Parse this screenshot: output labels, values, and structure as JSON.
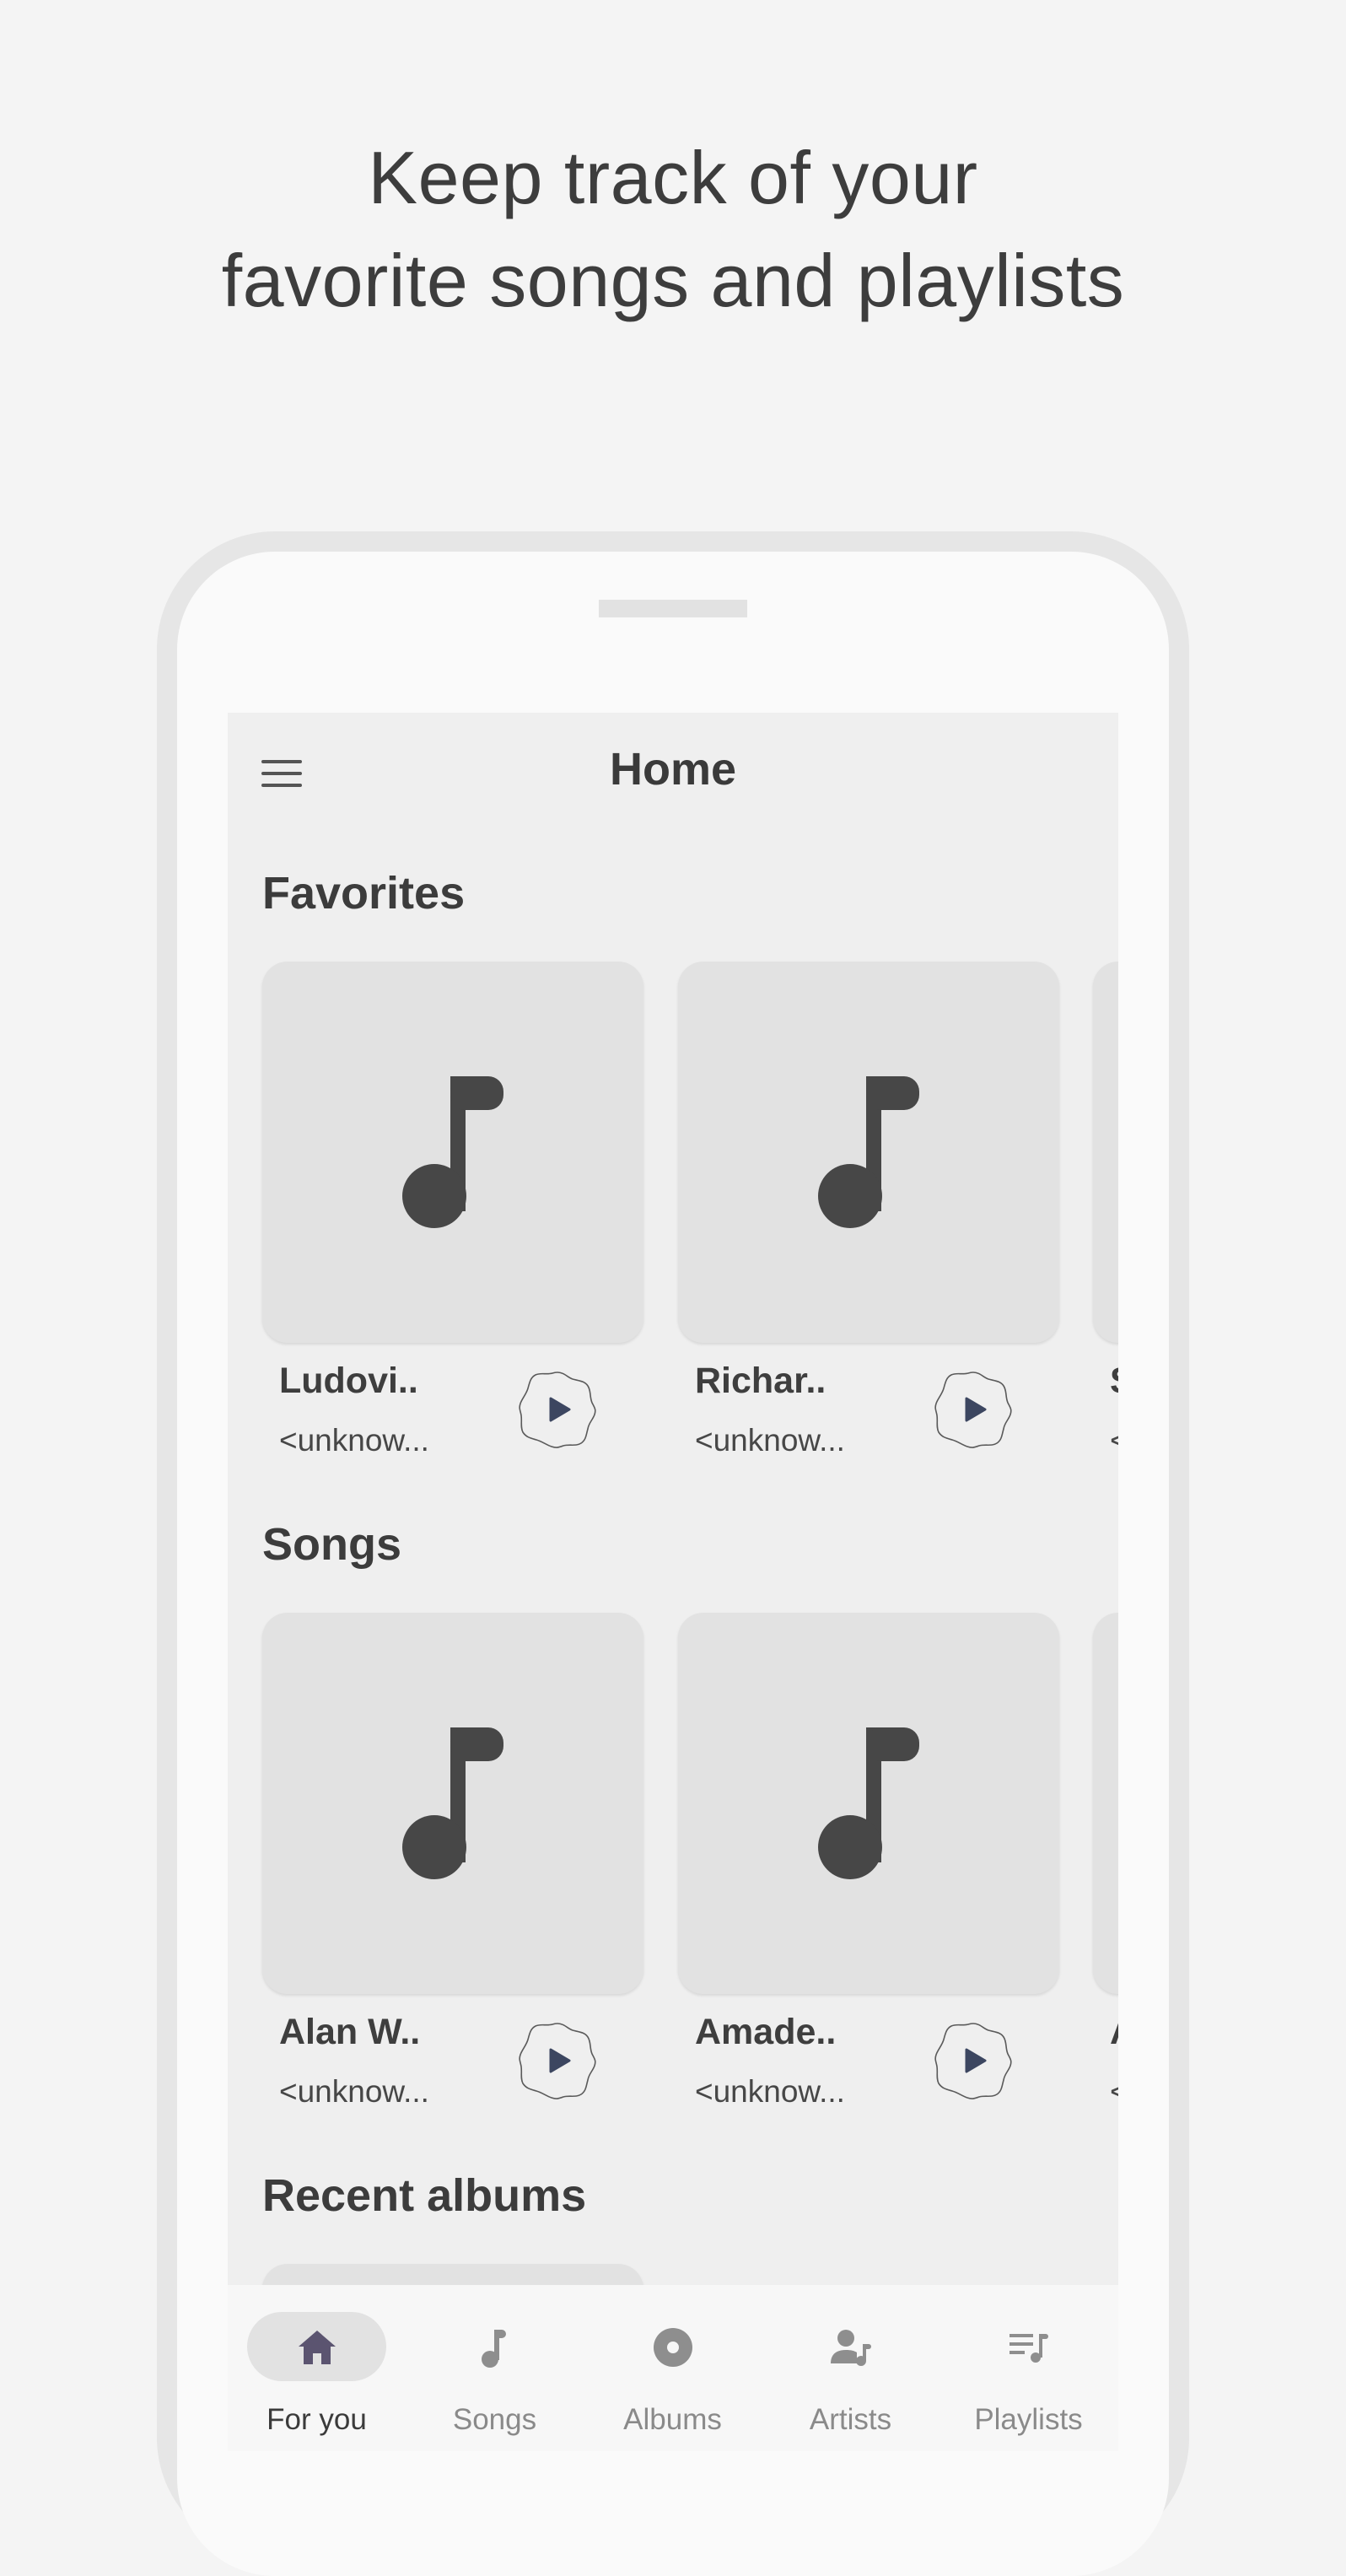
{
  "headline": {
    "line1": "Keep track of your",
    "line2": "favorite songs and playlists"
  },
  "app": {
    "title": "Home",
    "menu_icon": "menu-icon"
  },
  "favorites": {
    "title": "Favorites",
    "items": [
      {
        "title": "Ludovi..",
        "subtitle": "<unknow..."
      },
      {
        "title": "Richar..",
        "subtitle": "<unknow..."
      },
      {
        "title": "S",
        "subtitle": "<"
      }
    ]
  },
  "songs": {
    "title": "Songs",
    "items": [
      {
        "title": "Alan W..",
        "subtitle": "<unknow..."
      },
      {
        "title": "Amade..",
        "subtitle": "<unknow..."
      },
      {
        "title": "A",
        "subtitle": "<"
      }
    ]
  },
  "recent_albums": {
    "title": "Recent albums"
  },
  "bottom_nav": {
    "items": [
      {
        "label": "For you",
        "icon": "home-icon",
        "active": true
      },
      {
        "label": "Songs",
        "icon": "music-note-icon",
        "active": false
      },
      {
        "label": "Albums",
        "icon": "album-icon",
        "active": false
      },
      {
        "label": "Artists",
        "icon": "artist-icon",
        "active": false
      },
      {
        "label": "Playlists",
        "icon": "playlist-icon",
        "active": false
      }
    ]
  },
  "colors": {
    "background": "#f4f4f4",
    "screen": "#efefef",
    "card": "#e2e2e2",
    "icon_dark": "#474747",
    "active_nav_icon": "#5b5470",
    "play_triangle": "#3c4660"
  }
}
